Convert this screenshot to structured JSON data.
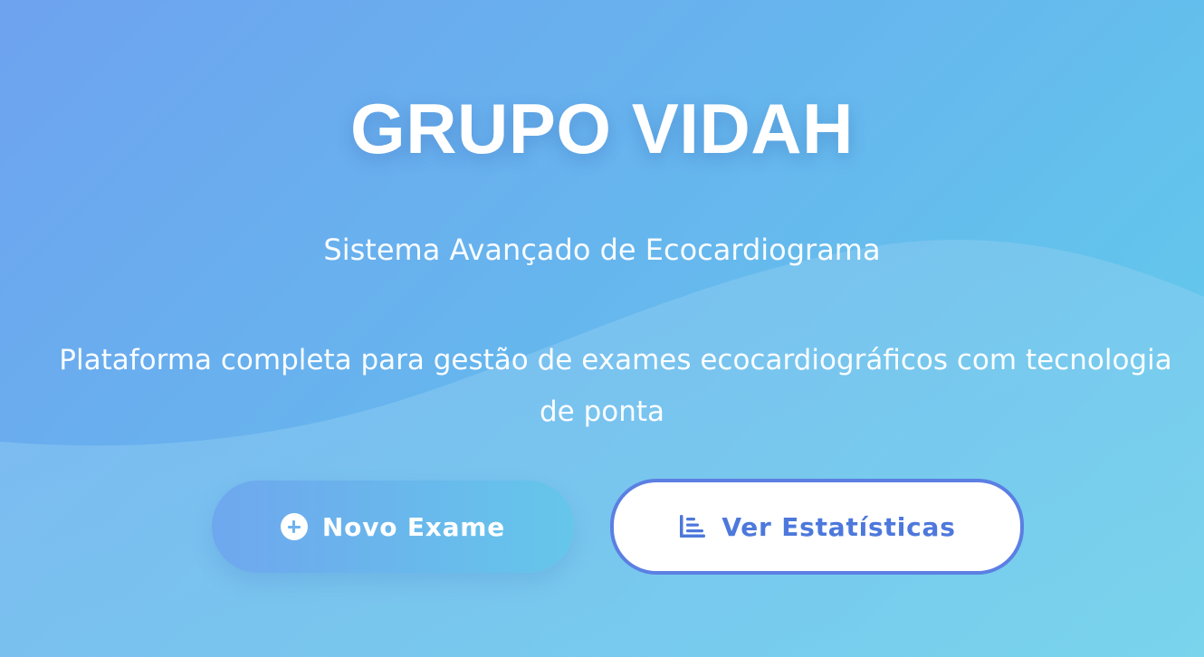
{
  "hero": {
    "title": "GRUPO VIDAH",
    "subtitle": "Sistema Avançado de Ecocardiograma",
    "description_line1": "Plataforma completa para gestão de exames ecocardiográficos com tecnologia",
    "description_line2": "de ponta"
  },
  "actions": {
    "primary": {
      "label": "Novo Exame",
      "icon": "plus-circle-icon"
    },
    "secondary": {
      "label": "Ver Estatísticas",
      "icon": "bar-chart-icon"
    }
  },
  "colors": {
    "background_start": "#6ea3ef",
    "background_end": "#6acfe9",
    "accent": "#5b7fe3",
    "text_on_background": "#ffffff"
  }
}
